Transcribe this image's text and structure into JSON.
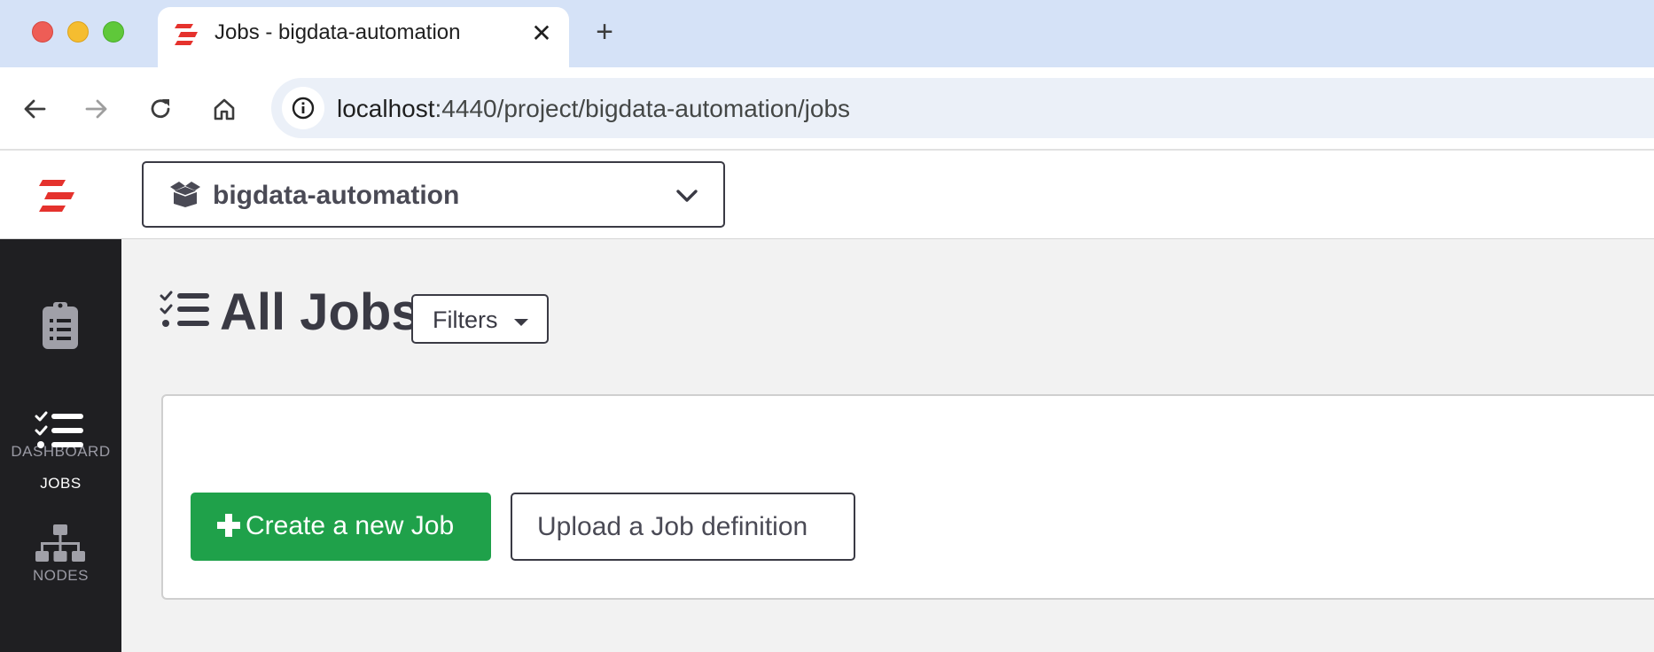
{
  "browser": {
    "tab_title": "Jobs - bigdata-automation",
    "url_host": "localhost",
    "url_path": ":4440/project/bigdata-automation/jobs"
  },
  "app": {
    "project_name": "bigdata-automation",
    "brand_color": "#e5322d"
  },
  "sidebar": {
    "items": [
      {
        "label": "DASHBOARD",
        "icon": "clipboard-icon",
        "active": false
      },
      {
        "label": "JOBS",
        "icon": "task-list-icon",
        "active": true
      },
      {
        "label": "NODES",
        "icon": "sitemap-icon",
        "active": false
      }
    ]
  },
  "main": {
    "title": "All Jobs",
    "filters_label": "Filters",
    "create_label": "Create a new Job",
    "upload_label": "Upload a Job definition",
    "create_color": "#1fa14a"
  }
}
